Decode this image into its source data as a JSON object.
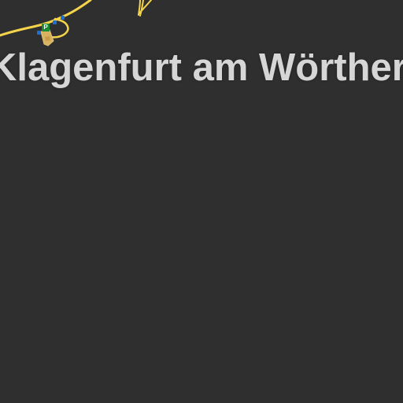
{
  "map": {
    "background_color": "#2f2f2f",
    "road_color": "#f5d44b",
    "building_color": "#d9b25f",
    "label_color": "#d6d6d6",
    "city_label": "Klagenfurt am Wörthersee",
    "poi_icon": {
      "name": "service-area-icon",
      "glyph": "P"
    },
    "junction_icons": [
      "motorway-junction-icon",
      "motorway-junction-icon",
      "motorway-junction-icon"
    ]
  }
}
